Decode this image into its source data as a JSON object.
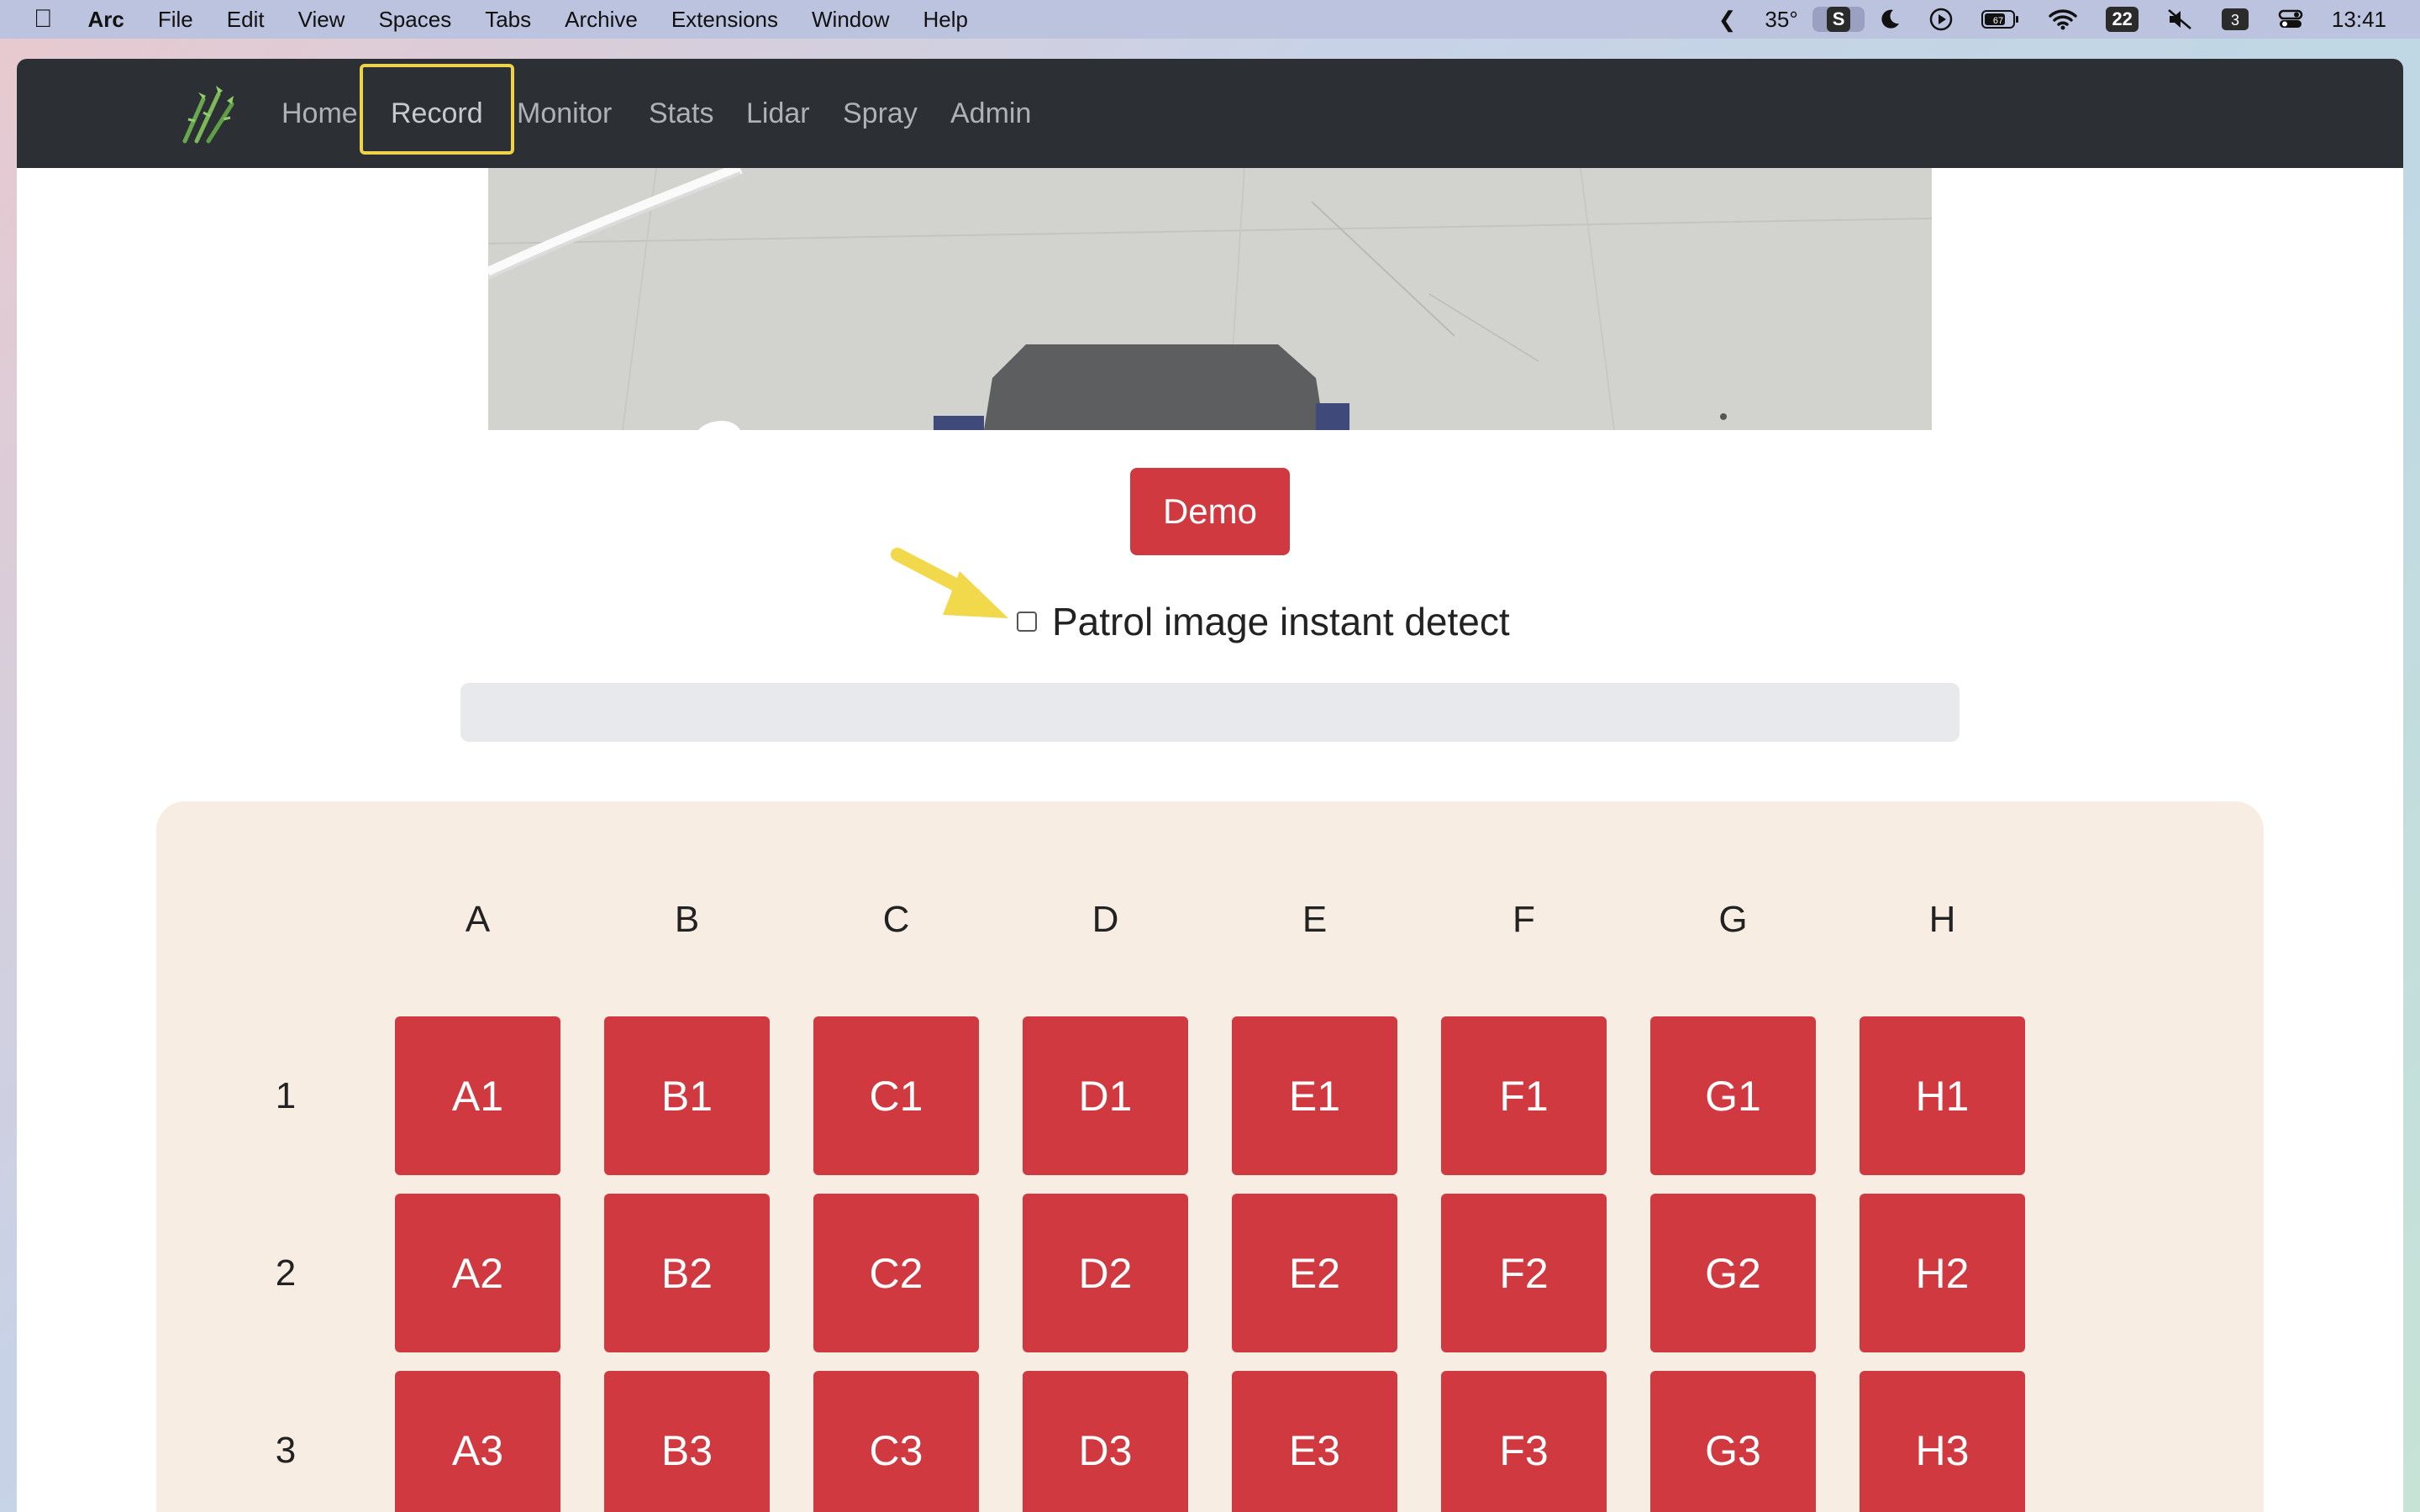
{
  "menubar": {
    "app": "Arc",
    "items": [
      "File",
      "Edit",
      "View",
      "Spaces",
      "Tabs",
      "Archive",
      "Extensions",
      "Window",
      "Help"
    ],
    "weather": "35°",
    "s_badge": "S",
    "battery": "67",
    "calendar": "22",
    "time": "13:41"
  },
  "nav": {
    "items": [
      "Home",
      "Record",
      "Monitor",
      "Stats",
      "Lidar",
      "Spray",
      "Admin"
    ],
    "active": "Record"
  },
  "demo_label": "Demo",
  "patrol": {
    "label": "Patrol image instant detect",
    "checked": false
  },
  "progress": {
    "value": 0
  },
  "grid": {
    "columns": [
      "A",
      "B",
      "C",
      "D",
      "E",
      "F",
      "G",
      "H"
    ],
    "rows": [
      "1",
      "2",
      "3"
    ],
    "cells": [
      [
        "A1",
        "B1",
        "C1",
        "D1",
        "E1",
        "F1",
        "G1",
        "H1"
      ],
      [
        "A2",
        "B2",
        "C2",
        "D2",
        "E2",
        "F2",
        "G2",
        "H2"
      ],
      [
        "A3",
        "B3",
        "C3",
        "D3",
        "E3",
        "F3",
        "G3",
        "H3"
      ]
    ]
  },
  "colors": {
    "accent": "#d0393f",
    "navbar": "#2c3034",
    "panel": "#f7ede2",
    "highlight": "#f0d24a"
  }
}
